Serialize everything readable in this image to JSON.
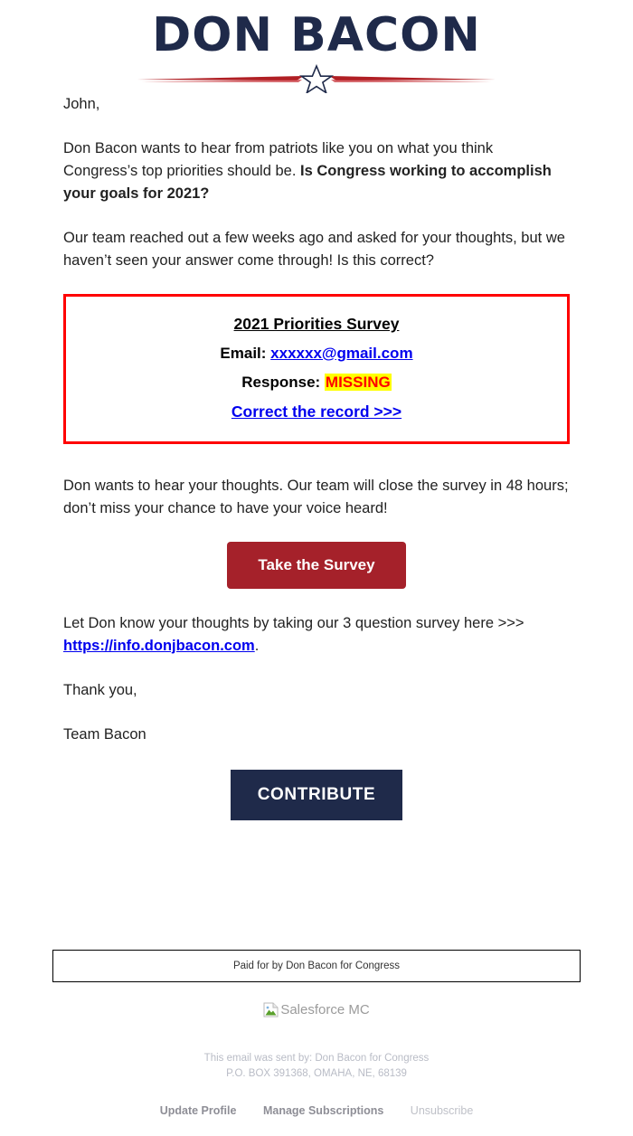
{
  "header": {
    "logo_name": "DON BACON",
    "divider_icon": "star-divider-icon",
    "navy": "#1f2a4a",
    "red": "#a5212a"
  },
  "body": {
    "greeting": "John,",
    "para1_plain": "Don Bacon wants to hear from patriots like you on what you think Congress’s top priorities should be. ",
    "para1_bold": "Is Congress working to accomplish your goals for 2021?",
    "para2": "Our team reached out a few weeks ago and asked for your thoughts, but we haven’t seen your answer come through! Is this correct?",
    "para3": "Don wants to hear your thoughts. Our team will close the survey in 48 hours; don’t miss your chance to have your voice heard!",
    "para4_plain": "Let Don know your thoughts by taking our 3 question survey here >>> ",
    "para4_link": "https://info.donjbacon.com",
    "para4_period": ".",
    "signoff": "Thank you,",
    "team": "Team Bacon"
  },
  "survey_box": {
    "title": "2021 Priorities Survey",
    "email_label": "Email: ",
    "email_value": "xxxxxx@gmail.com",
    "response_label": "Response: ",
    "response_value": "MISSING",
    "correct_link": "Correct the record >>>",
    "border_color": "#ff0000",
    "highlight_color": "#ffff00",
    "missing_color": "#ff0000",
    "link_color": "#0000ee"
  },
  "buttons": {
    "survey": "Take the Survey",
    "contribute": "CONTRIBUTE"
  },
  "footer": {
    "paid_for": "Paid for by Don Bacon for Congress",
    "broken_image_icon": "broken-image-icon",
    "broken_image_alt": "Salesforce MC",
    "sent_by_line1": "This email was sent by: Don Bacon for Congress",
    "sent_by_line2": "P.O. BOX 391368, OMAHA, NE, 68139",
    "links": [
      {
        "label": "Update Profile",
        "style": "strong"
      },
      {
        "label": "Manage Subscriptions",
        "style": "strong"
      },
      {
        "label": "Unsubscribe",
        "style": "light"
      }
    ]
  }
}
